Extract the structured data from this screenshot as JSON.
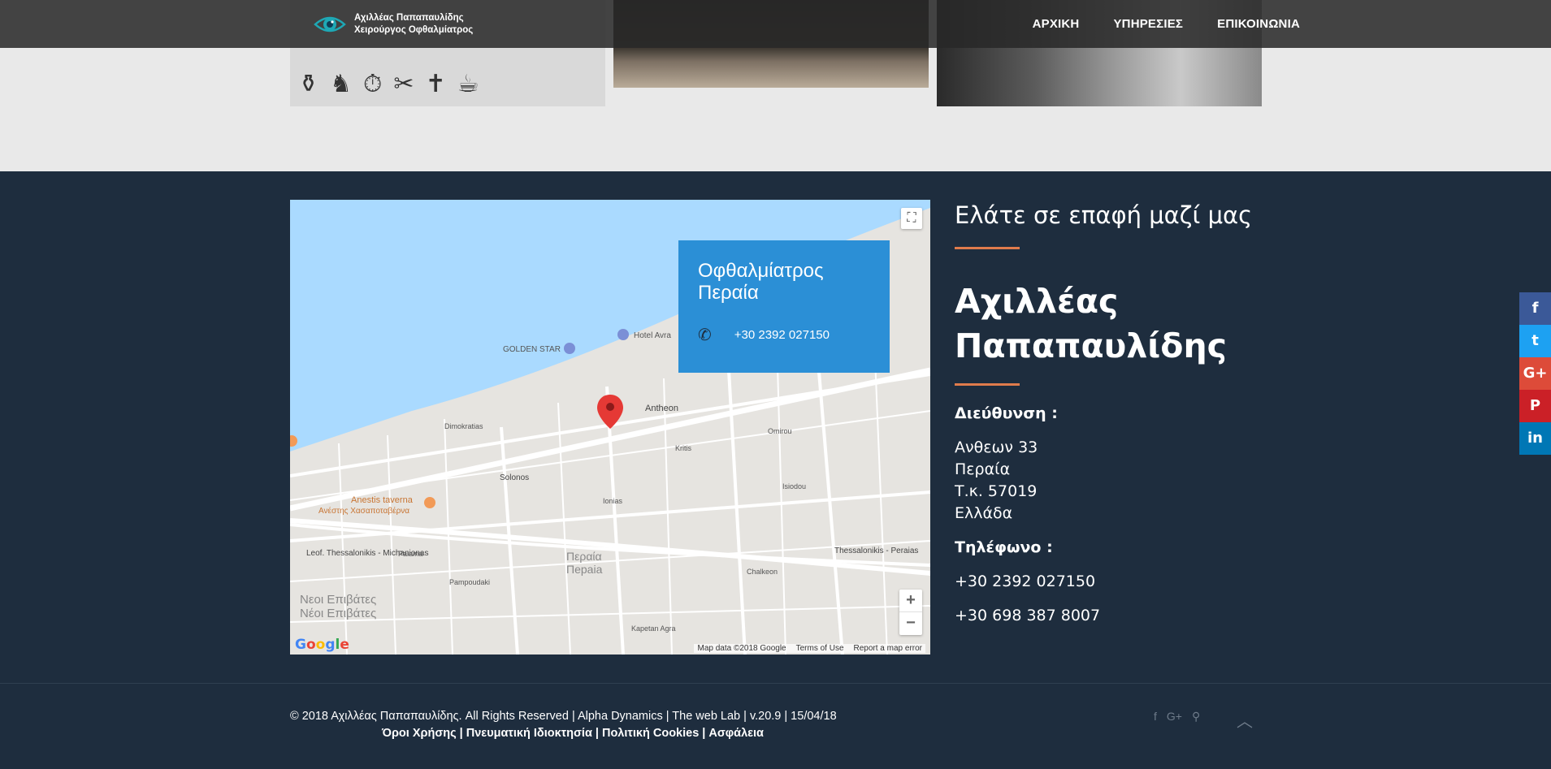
{
  "brand": {
    "line1": "Αχιλλέας Παπαπαυλίδης",
    "line2": "Χειρούργος Οφθαλμίατρος"
  },
  "nav": {
    "items": [
      "ΑΡΧΙΚΗ",
      "ΥΠΗΡΕΣΙΕΣ",
      "ΕΠΙΚΟΙΝΩΝΙΑ"
    ]
  },
  "map": {
    "info_title_line1": "Οφθαλμίατρος",
    "info_title_line2": "Περαία",
    "info_phone": "+30 2392 027150",
    "google_logo": "Google",
    "footer": [
      "Map data ©2018 Google",
      "Terms of Use",
      "Report a map error"
    ],
    "zoom_in": "+",
    "zoom_out": "−",
    "labels": [
      "GOLDEN STAR",
      "Hotel Avra",
      "Anestis taverna",
      "Ανέστης Χασαποταβέρνα",
      "Περαία",
      "Πepaia",
      "Νεοι Επιβάτες",
      "Νέοι Επιβάτες",
      "Antheon",
      "Solonos",
      "Leof. Thessalonikis - Michanionas",
      "Thessalonikis - Peraias",
      "Omirou",
      "Kritis",
      "Ionias",
      "Dimokratias",
      "Palama",
      "Pampoudaki",
      "Isiodou",
      "Chalkeon",
      "Kapetan Agra"
    ]
  },
  "contact": {
    "heading": "Ελάτε σε επαφή μαζί μας",
    "name_line1": "Αχιλλέας",
    "name_line2": "Παπαπαυλίδης",
    "address_label": "Διεύθυνση :",
    "address": [
      "Ανθεων 33",
      "Περαία",
      "Τ.κ. 57019",
      "Ελλάδα"
    ],
    "phone_label": "Τηλέφωνο :",
    "phones": [
      "+30 2392 027150",
      "+30 698 387 8007"
    ]
  },
  "footer": {
    "copyright": "© 2018 Αχιλλέας Παπαπαυλίδης. All Rights Reserved | Alpha Dynamics | The web Lab | v.20.9 | 15/04/18",
    "links": "Όροι Χρήσης | Πνευματική Ιδιοκτησία | Πολιτική Cookies | Ασφάλεια",
    "icons": [
      "f",
      "G+",
      "⚲"
    ],
    "to_top": "︿"
  },
  "share": {
    "items": [
      {
        "label": "f",
        "color": "#3b5998"
      },
      {
        "label": "t",
        "color": "#1da1f2"
      },
      {
        "label": "G+",
        "color": "#dd4b39"
      },
      {
        "label": "P",
        "color": "#cb2027"
      },
      {
        "label": "in",
        "color": "#0077b5"
      }
    ]
  },
  "colors": {
    "footer_bg": "#1e2d3e",
    "accent": "#e07b4c",
    "info_box": "#2b8fd6"
  }
}
